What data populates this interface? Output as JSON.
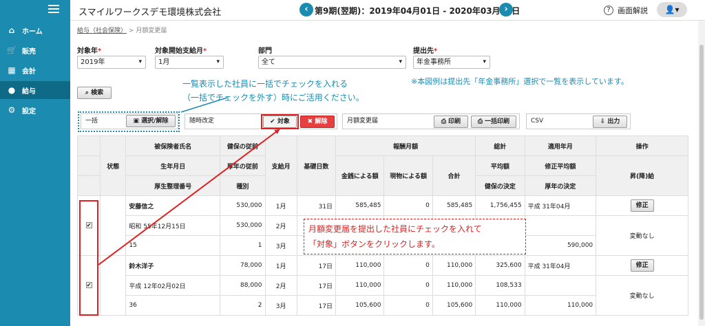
{
  "sidebar": {
    "items": [
      {
        "label": "ホーム",
        "icon": "home-icon"
      },
      {
        "label": "販売",
        "icon": "cart-icon"
      },
      {
        "label": "会計",
        "icon": "calculator-icon"
      },
      {
        "label": "給与",
        "icon": "money-bag-icon"
      },
      {
        "label": "設定",
        "icon": "gear-icon"
      }
    ]
  },
  "header": {
    "company": "スマイルワークスデモ環境株式会社",
    "period": "第9期(翌期)：2019年04月01日 - 2020年03月31日",
    "help": "画面解説"
  },
  "breadcrumb": {
    "link": "給与（社会保険）",
    "sep": ">",
    "current": "月額変更届"
  },
  "filters": {
    "year_label": "対象年",
    "year_value": "2019年",
    "month_label": "対象開始支給月",
    "month_value": "1月",
    "dept_label": "部門",
    "dept_value": "全て",
    "dest_label": "提出先",
    "dest_value": "年金事務所",
    "required": "*"
  },
  "search_label": "検索",
  "callout1": {
    "line1": "一覧表示した社員に一括でチェックを入れる",
    "line2": "（一括でチェックを外す）時にご活用ください。"
  },
  "callout2": "※本図例は提出先「年金事務所」選択で一覧を表示しています。",
  "panels": {
    "bulk_label": "一括",
    "bulk_btn": "選択/解除",
    "adhoc_label": "随時改定",
    "target_btn": "対象",
    "release_btn": "解除",
    "monthly_label": "月額変更届",
    "print_btn": "印刷",
    "bulk_print_btn": "一括印刷",
    "csv_label": "CSV",
    "output_btn": "出力"
  },
  "table": {
    "headers": {
      "status": "状態",
      "name": "被保険者氏名",
      "birth": "生年月日",
      "number": "厚生整理番号",
      "health_prev": "健保の従前",
      "pension_prev": "厚年の従前",
      "type": "種別",
      "month": "支給月",
      "days": "基礎日数",
      "remuneration": "報酬月額",
      "cash": "金銭による額",
      "kind": "現物による額",
      "total": "合計",
      "sum": "総計",
      "avg": "平均額",
      "health_dec": "健保の決定",
      "apply": "適用年月",
      "rev_avg": "修正平均額",
      "pension_dec": "厚年の決定",
      "op": "操作",
      "raise": "昇(降)給"
    },
    "rows": [
      {
        "c1": "安藤信之",
        "c2": "530,000",
        "c3": "1月",
        "c4": "31日",
        "c5": "585,485",
        "c6": "0",
        "c7": "585,485",
        "c8": "1,756,455",
        "c9": "平成 31年04月",
        "btn": "修正"
      },
      {
        "c1": "昭和 55年12月15日",
        "c2": "530,000",
        "c3": "2月",
        "c4": "",
        "c5": "",
        "c6": "",
        "c7": "",
        "c8": "5",
        "c9": "",
        "btn": ""
      },
      {
        "c1": "15",
        "c2": "1",
        "c3": "3月",
        "c4": "",
        "c5": "",
        "c6": "",
        "c7": "",
        "c8": "0",
        "c9": "590,000",
        "btn": "変動なし"
      },
      {
        "c1": "鈴木洋子",
        "c2": "78,000",
        "c3": "1月",
        "c4": "17日",
        "c5": "110,000",
        "c6": "0",
        "c7": "110,000",
        "c8": "325,600",
        "c9": "平成 31年04月",
        "btn": "修正"
      },
      {
        "c1": "平成 12年02月02日",
        "c2": "88,000",
        "c3": "2月",
        "c4": "17日",
        "c5": "110,000",
        "c6": "0",
        "c7": "110,000",
        "c8": "108,533",
        "c9": "",
        "btn": ""
      },
      {
        "c1": "36",
        "c2": "2",
        "c3": "3月",
        "c4": "17日",
        "c5": "105,600",
        "c6": "0",
        "c7": "105,600",
        "c8": "110,000",
        "c9": "110,000",
        "btn": "変動なし"
      }
    ]
  },
  "message": {
    "line1": "月額変更届を提出した社員にチェックを入れて",
    "line2": "「対象」ボタンをクリックします。"
  },
  "colors": {
    "accent": "#1b8bb0",
    "red": "#e02020"
  }
}
